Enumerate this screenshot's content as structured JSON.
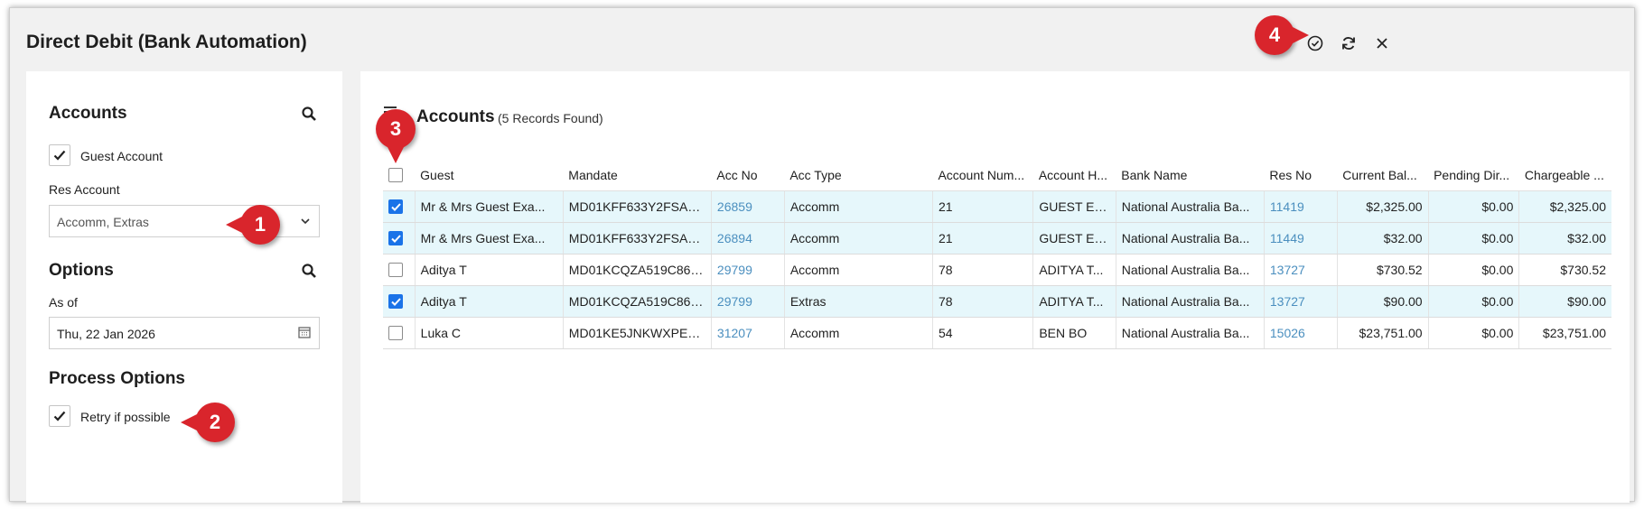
{
  "window": {
    "title": "Direct Debit (Bank Automation)",
    "icons": [
      "check-circle-icon",
      "refresh-icon",
      "close-icon"
    ]
  },
  "callouts": [
    "1",
    "2",
    "3",
    "4"
  ],
  "left": {
    "accounts_title": "Accounts",
    "guest_account_label": "Guest Account",
    "guest_account_checked": true,
    "res_account_label": "Res Account",
    "res_account_value": "Accomm, Extras",
    "options_title": "Options",
    "as_of_label": "As of",
    "as_of_value": "Thu, 22 Jan 2026",
    "process_options_title": "Process Options",
    "retry_label": "Retry if possible",
    "retry_checked": true
  },
  "grid": {
    "title": "Accounts",
    "count": "(5 Records Found)",
    "columns": [
      "Guest",
      "Mandate",
      "Acc No",
      "Acc Type",
      "Account Num...",
      "Account H...",
      "Bank Name",
      "Res No",
      "Current Bal...",
      "Pending Dir...",
      "Chargeable ..."
    ],
    "rows": [
      {
        "checked": true,
        "cells": [
          "Mr & Mrs Guest Exa...",
          "MD01KFF633Y2FSAE...",
          "26859",
          "Accomm",
          "21",
          "GUEST EX...",
          "National Australia Ba...",
          "11419",
          "$2,325.00",
          "$0.00",
          "$2,325.00"
        ]
      },
      {
        "checked": true,
        "cells": [
          "Mr & Mrs Guest Exa...",
          "MD01KFF633Y2FSAE...",
          "26894",
          "Accomm",
          "21",
          "GUEST EX...",
          "National Australia Ba...",
          "11449",
          "$32.00",
          "$0.00",
          "$32.00"
        ]
      },
      {
        "checked": false,
        "cells": [
          "Aditya T",
          "MD01KCQZA519C86E...",
          "29799",
          "Accomm",
          "78",
          "ADITYA T...",
          "National Australia Ba...",
          "13727",
          "$730.52",
          "$0.00",
          "$730.52"
        ]
      },
      {
        "checked": true,
        "cells": [
          "Aditya T",
          "MD01KCQZA519C86E...",
          "29799",
          "Extras",
          "78",
          "ADITYA T...",
          "National Australia Ba...",
          "13727",
          "$90.00",
          "$0.00",
          "$90.00"
        ]
      },
      {
        "checked": false,
        "cells": [
          "Luka C",
          "MD01KE5JNKWXPEK...",
          "31207",
          "Accomm",
          "54",
          "BEN BO",
          "National Australia Ba...",
          "15026",
          "$23,751.00",
          "$0.00",
          "$23,751.00"
        ]
      }
    ]
  },
  "colors": {
    "accent": "#1a73e8",
    "link": "#4b8fbf",
    "callout": "#d9252c",
    "selected_row": "#e6f7fb"
  }
}
